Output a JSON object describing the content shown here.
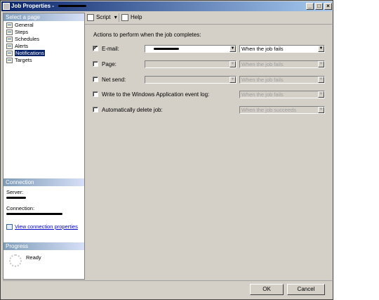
{
  "window": {
    "title": "Job Properties - "
  },
  "left": {
    "select_header": "Select a page",
    "items": [
      {
        "label": "General"
      },
      {
        "label": "Steps"
      },
      {
        "label": "Schedules"
      },
      {
        "label": "Alerts"
      },
      {
        "label": "Notifications"
      },
      {
        "label": "Targets"
      }
    ],
    "connection_header": "Connection",
    "server_label": "Server:",
    "connection_label": "Connection:",
    "view_link": "View connection properties",
    "progress_header": "Progress",
    "progress_status": "Ready"
  },
  "toolbar": {
    "script_label": "Script",
    "script_arrow": "▾",
    "help_label": "Help"
  },
  "main": {
    "intro": "Actions to perform when the job completes:",
    "rows": [
      {
        "label": "E-mail:",
        "checked": true,
        "check_mark": "✓",
        "value": "",
        "condition": "When the job fails"
      },
      {
        "label": "Page:",
        "checked": false,
        "value": "",
        "condition": "When the job fails"
      },
      {
        "label": "Net send:",
        "checked": false,
        "value": "",
        "condition": "When the job fails"
      },
      {
        "label": "Write to the Windows Application event log:",
        "checked": false,
        "condition": "When the job fails"
      },
      {
        "label": "Automatically delete job:",
        "checked": false,
        "condition": "When the job succeeds"
      }
    ]
  },
  "buttons": {
    "ok": "OK",
    "cancel": "Cancel"
  },
  "colors": {
    "dialog_bg": "#d4d0c8",
    "title_blue": "#0a246a",
    "link": "#0000cc"
  },
  "icons": {
    "minimize": "_",
    "maximize": "□",
    "close": "×",
    "dropdown": "▼"
  }
}
